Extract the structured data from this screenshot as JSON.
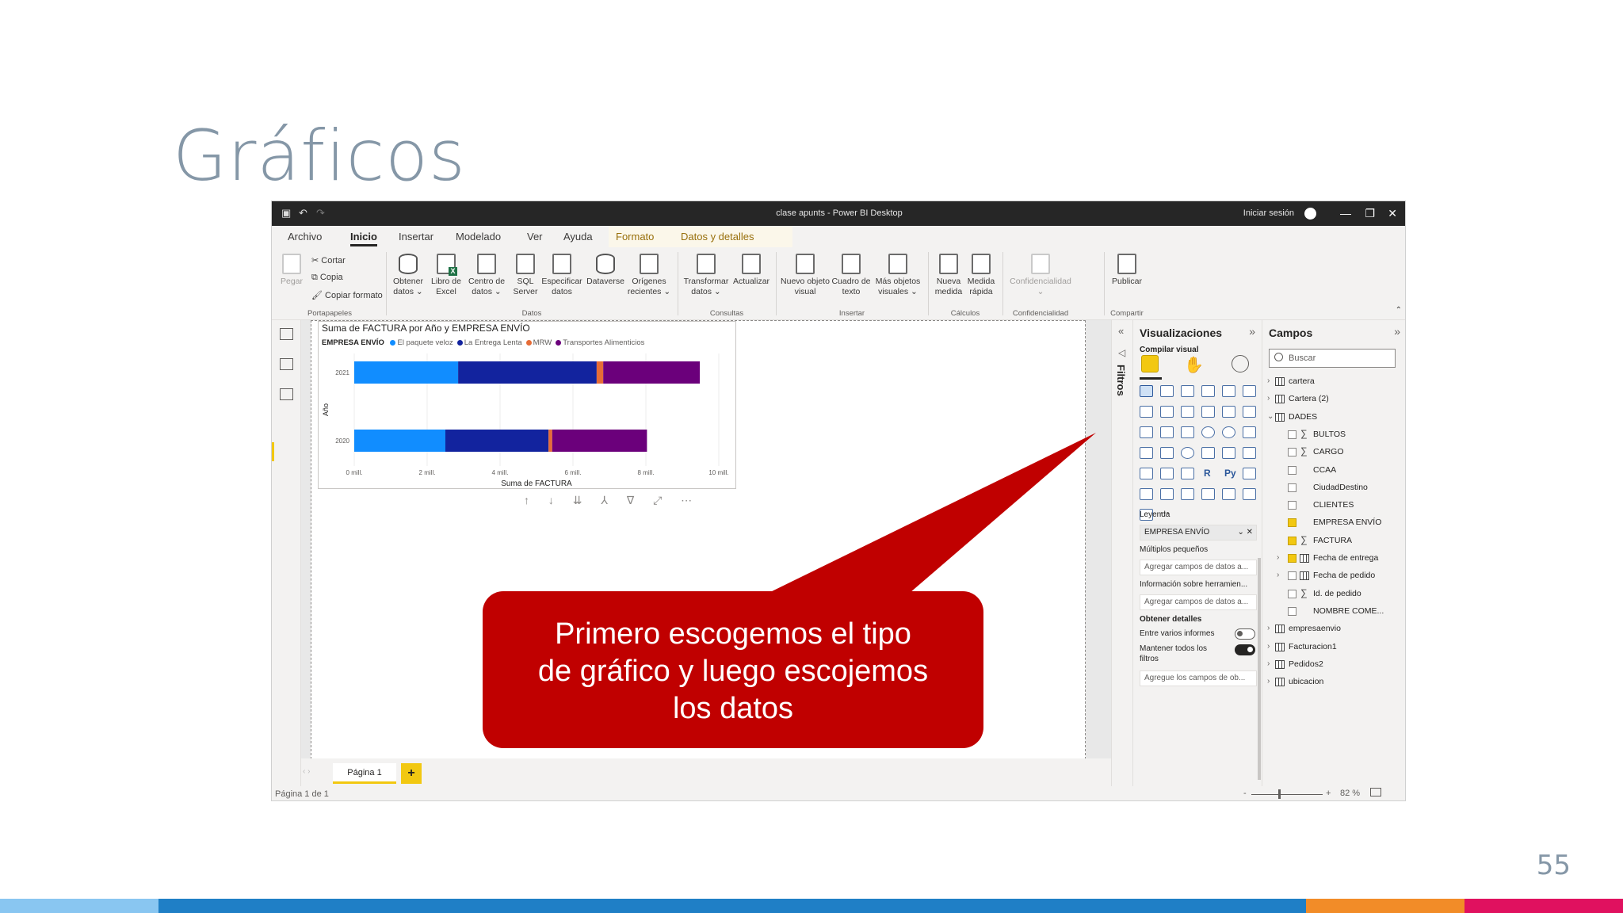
{
  "slide": {
    "title": "Gráficos",
    "page_number": "55",
    "bottom_bar_colors": [
      "#89c6f1",
      "#1f7fc6",
      "#f28c28",
      "#e0115f"
    ]
  },
  "window": {
    "title": "clase apunts - Power BI Desktop",
    "signin": "Iniciar sesión",
    "controls": {
      "minimize": "—",
      "restore": "❐",
      "close": "✕"
    }
  },
  "menu": {
    "tabs": [
      "Archivo",
      "Inicio",
      "Insertar",
      "Modelado",
      "Ver",
      "Ayuda",
      "Formato",
      "Datos y detalles"
    ],
    "active": "Inicio"
  },
  "ribbon": {
    "clipboard": {
      "paste": "Pegar",
      "cut": "Cortar",
      "copy": "Copia",
      "format_painter": "Copiar formato",
      "group": "Portapapeles"
    },
    "data": {
      "get_data": [
        "Obtener",
        "datos ⌄"
      ],
      "excel": [
        "Libro de",
        "Excel"
      ],
      "data_hub": [
        "Centro de",
        "datos ⌄"
      ],
      "sql": [
        "SQL",
        "Server"
      ],
      "enter_data": [
        "Especificar",
        "datos"
      ],
      "dataverse": [
        "Dataverse",
        ""
      ],
      "recent": [
        "Orígenes",
        "recientes ⌄"
      ],
      "group": "Datos"
    },
    "queries": {
      "transform": [
        "Transformar",
        "datos ⌄"
      ],
      "refresh": [
        "Actualizar",
        ""
      ],
      "group": "Consultas"
    },
    "insert": {
      "new_visual": [
        "Nuevo objeto",
        "visual"
      ],
      "text_box": [
        "Cuadro de",
        "texto"
      ],
      "more_visuals": [
        "Más objetos",
        "visuales ⌄"
      ],
      "group": "Insertar"
    },
    "calculations": {
      "new_measure": [
        "Nueva",
        "medida"
      ],
      "quick_measure": [
        "Medida",
        "rápida"
      ],
      "group": "Cálculos"
    },
    "sensitivity": {
      "label": [
        "Confidencialidad",
        "⌄"
      ],
      "group": "Confidencialidad"
    },
    "share": {
      "publish": [
        "Publicar",
        ""
      ],
      "group": "Compartir"
    }
  },
  "visual": {
    "title": "Suma de FACTURA por Año y EMPRESA ENVÍO",
    "legend_title": "EMPRESA ENVÍO",
    "toolbar_icons": "↑ ↓ ⇊ ⅄ ∇ ⤢ ⋯"
  },
  "chart_data": {
    "type": "bar",
    "orientation": "horizontal",
    "stacked": true,
    "title": "Suma de FACTURA por Año y EMPRESA ENVÍO",
    "xlabel": "Suma de FACTURA",
    "ylabel": "Año",
    "categories": [
      "2021",
      "2020"
    ],
    "xlim": [
      0,
      10000000
    ],
    "x_ticks": [
      "0 mill.",
      "2 mill.",
      "4 mill.",
      "6 mill.",
      "8 mill.",
      "10 mill."
    ],
    "legend_title": "EMPRESA ENVÍO",
    "legend_position": "top-left",
    "series": [
      {
        "name": "El paquete veloz",
        "color": "#118dff",
        "values": [
          2850000,
          2500000
        ]
      },
      {
        "name": "La Entrega Lenta",
        "color": "#12239e",
        "values": [
          3800000,
          2830000
        ]
      },
      {
        "name": "MRW",
        "color": "#e66c37",
        "values": [
          180000,
          100000
        ]
      },
      {
        "name": "Transportes Alimenticios",
        "color": "#6b007b",
        "values": [
          2650000,
          2600000
        ]
      }
    ]
  },
  "callout": {
    "lines": [
      "Primero escogemos el tipo",
      "de gráfico y luego escojemos",
      "los datos"
    ],
    "color": "#c00000"
  },
  "pages": {
    "tab": "Página 1",
    "add": "+",
    "nav": "‹  ›"
  },
  "status": {
    "text": "Página 1 de 1",
    "zoom": "82 %",
    "minus": "-",
    "plus": "+"
  },
  "filters": {
    "label": "Filtros"
  },
  "visualizations": {
    "title": "Visualizaciones",
    "compile": "Compilar visual",
    "r_label": "R",
    "py_label": "Py",
    "more": "···",
    "legend": "Leyenda",
    "legend_value": "EMPRESA ENVÍO",
    "small_multiples": "Múltiplos pequeños",
    "small_multiples_placeholder": "Agregar campos de datos a...",
    "tooltips": "Información sobre herramien...",
    "tooltips_placeholder": "Agregar campos de datos a...",
    "drillthrough": "Obtener detalles",
    "cross_report": "Entre varios informes",
    "keep_filters": [
      "Mantener todos los",
      "filtros"
    ],
    "drill_placeholder": "Agregue los campos de ob..."
  },
  "fields": {
    "title": "Campos",
    "search_placeholder": "Buscar",
    "tables_before": [
      "cartera",
      "Cartera (2)"
    ],
    "expanded_table": "DADES",
    "dades_fields": [
      {
        "name": "BULTOS",
        "sigma": true,
        "checked": false
      },
      {
        "name": "CARGO",
        "sigma": true,
        "checked": false
      },
      {
        "name": "CCAA",
        "sigma": false,
        "checked": false
      },
      {
        "name": "CiudadDestino",
        "sigma": false,
        "checked": false
      },
      {
        "name": "CLIENTES",
        "sigma": false,
        "checked": false
      },
      {
        "name": "EMPRESA ENVÍO",
        "sigma": false,
        "checked": true
      },
      {
        "name": "FACTURA",
        "sigma": true,
        "checked": true
      },
      {
        "name": "Fecha de entrega",
        "sigma": false,
        "checked": true
      },
      {
        "name": "Fecha de pedido",
        "sigma": false,
        "checked": false
      },
      {
        "name": "Id. de pedido",
        "sigma": true,
        "checked": false
      },
      {
        "name": "NOMBRE COME...",
        "sigma": false,
        "checked": false
      }
    ],
    "tables_after": [
      "empresaenvio",
      "Facturacion1",
      "Pedidos2",
      "ubicacion"
    ]
  }
}
